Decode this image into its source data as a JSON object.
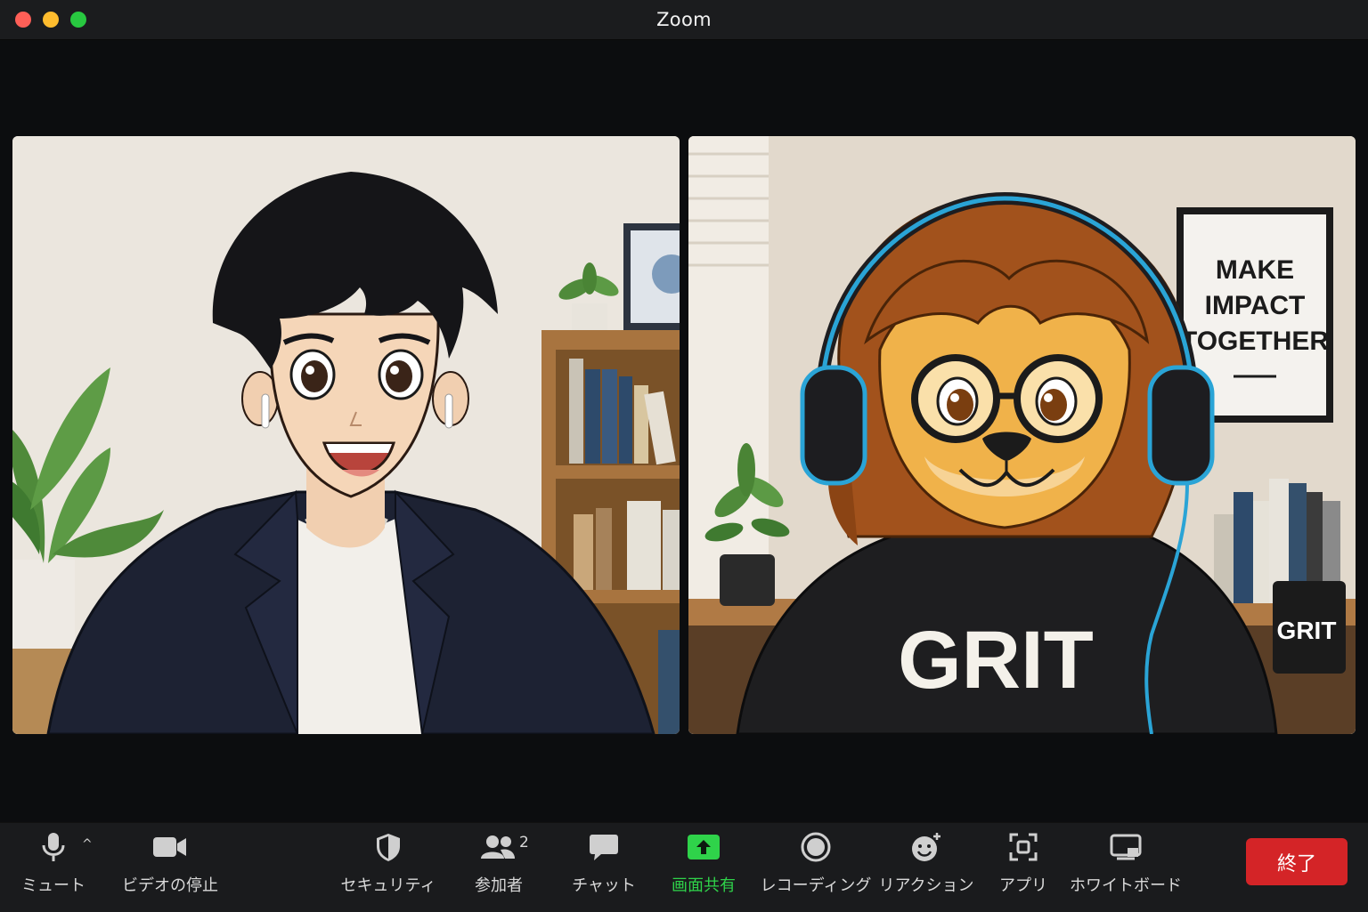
{
  "window": {
    "title": "Zoom"
  },
  "participants": [
    {
      "tile": "left"
    },
    {
      "tile": "right",
      "poster_text": [
        "MAKE",
        "IMPACT",
        "TOGETHER"
      ],
      "shirt_text": "GRIT",
      "mug_text": "GRIT"
    }
  ],
  "toolbar": {
    "mute_label": "ミュート",
    "video_label": "ビデオの停止",
    "security_label": "セキュリティ",
    "participants_label": "参加者",
    "participants_count": "2",
    "chat_label": "チャット",
    "share_label": "画面共有",
    "record_label": "レコーディング",
    "reactions_label": "リアクション",
    "apps_label": "アプリ",
    "whiteboard_label": "ホワイトボード",
    "end_label": "終了"
  },
  "icons": {
    "mute": "microphone-icon",
    "video": "video-camera-icon",
    "security": "shield-icon",
    "participants": "people-icon",
    "chat": "speech-bubble-icon",
    "share": "share-screen-arrow-icon",
    "record": "record-circle-icon",
    "reactions": "smiley-plus-icon",
    "apps": "apps-icon",
    "whiteboard": "whiteboard-icon"
  },
  "colors": {
    "share_green": "#2fd34a",
    "end_red": "#d42427",
    "toolbar_bg": "#1a1b1d"
  }
}
